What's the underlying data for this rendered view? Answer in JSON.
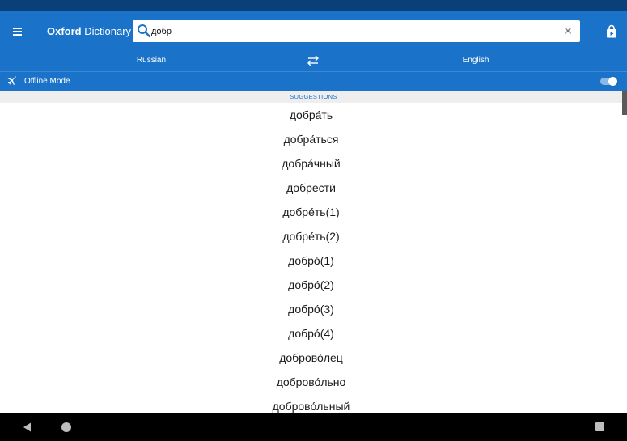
{
  "app": {
    "title_bold": "Oxford",
    "title_rest": " Dictionary",
    "brand_color": "#1a73c8"
  },
  "search": {
    "value": "добр",
    "placeholder": ""
  },
  "languages": {
    "source": "Russian",
    "target": "English",
    "swap_icon": "swap-arrows-icon"
  },
  "offline": {
    "label": "Offline Mode",
    "enabled": true
  },
  "suggestions": {
    "header": "SUGGESTIONS",
    "items": [
      "добра́ть",
      "добра́ться",
      "добра́чный",
      "добрести́",
      "добре́ть(1)",
      "добре́ть(2)",
      "добро́(1)",
      "добро́(2)",
      "добро́(3)",
      "добро́(4)",
      "доброво́лец",
      "доброво́льно",
      "доброво́льный"
    ]
  },
  "icons": {
    "menu": "menu-icon",
    "search": "search-icon",
    "clear": "close-icon",
    "store": "store-bag-icon",
    "offline": "airplane-icon"
  }
}
